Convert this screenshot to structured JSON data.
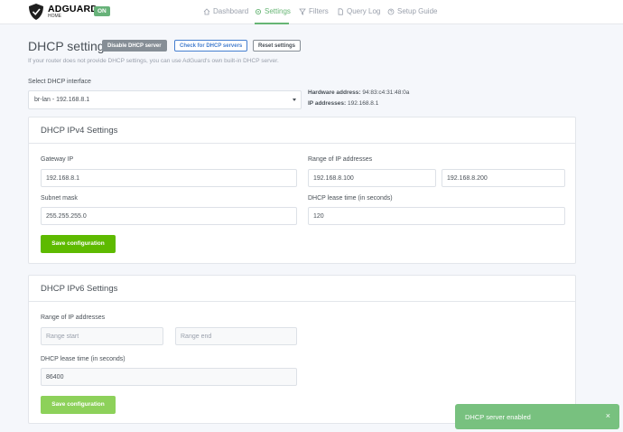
{
  "header": {
    "logo_title": "ADGUARD",
    "logo_sub": "HOME",
    "status_badge": "ON",
    "nav": [
      {
        "label": "Dashboard",
        "icon": "home-icon"
      },
      {
        "label": "Settings",
        "icon": "settings-icon",
        "active": true
      },
      {
        "label": "Filters",
        "icon": "filter-icon"
      },
      {
        "label": "Query Log",
        "icon": "document-icon"
      },
      {
        "label": "Setup Guide",
        "icon": "help-icon"
      }
    ]
  },
  "page": {
    "title": "DHCP settings",
    "buttons": {
      "disable": "Disable DHCP server",
      "check": "Check for DHCP servers",
      "reset": "Reset settings"
    },
    "description": "If your router does not provide DHCP settings, you can use AdGuard's own built-in DHCP server.",
    "interface_label": "Select DHCP interface",
    "interface_value": "br-lan - 192.168.8.1",
    "hardware_label": "Hardware address:",
    "hardware_value": "94:83:c4:31:48:0a",
    "ip_label": "IP addresses:",
    "ip_value": "192.168.8.1"
  },
  "ipv4": {
    "title": "DHCP IPv4 Settings",
    "gateway_label": "Gateway IP",
    "gateway_value": "192.168.8.1",
    "range_label": "Range of IP addresses",
    "range_start": "192.168.8.100",
    "range_end": "192.168.8.200",
    "subnet_label": "Subnet mask",
    "subnet_value": "255.255.255.0",
    "lease_label": "DHCP lease time (in seconds)",
    "lease_value": "120",
    "save": "Save configuration"
  },
  "ipv6": {
    "title": "DHCP IPv6 Settings",
    "range_label": "Range of IP addresses",
    "range_start_placeholder": "Range start",
    "range_end_placeholder": "Range end",
    "lease_label": "DHCP lease time (in seconds)",
    "lease_value": "86400",
    "save": "Save configuration"
  },
  "toast": {
    "message": "DHCP server enabled",
    "close": "×"
  },
  "colors": {
    "accent": "#66b574",
    "save_button": "#5eba00",
    "toast": "#78c17f"
  }
}
